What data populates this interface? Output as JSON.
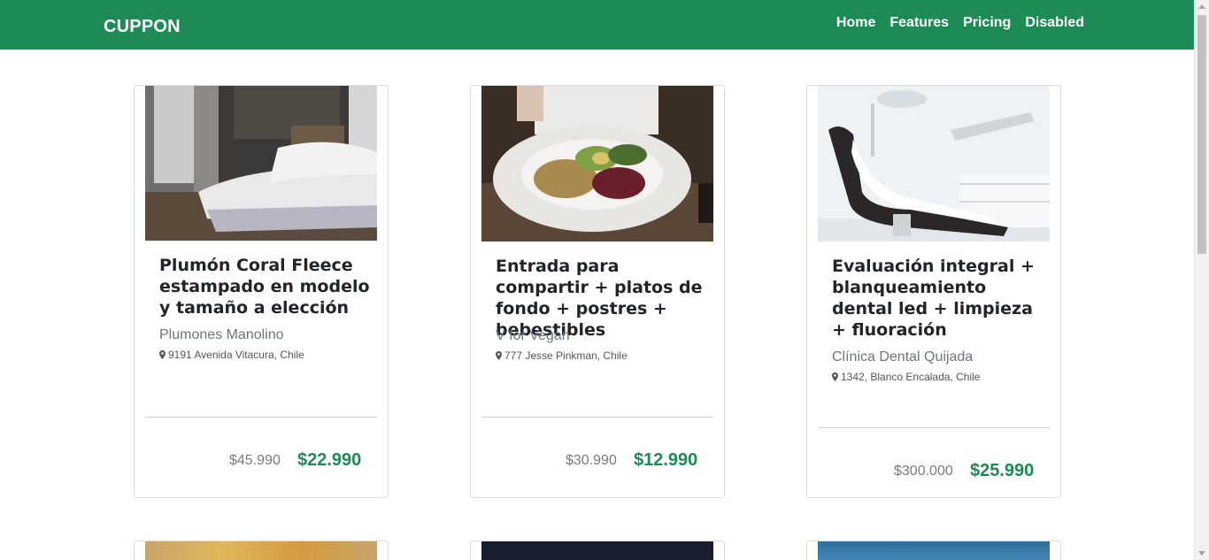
{
  "navbar": {
    "brand": "CUPPON",
    "links": [
      "Home",
      "Features",
      "Pricing",
      "Disabled"
    ]
  },
  "cards": [
    {
      "title": "Plumón Coral Fleece estampado en modelo y tamaño a elección",
      "vendor": "Plumones Manolino",
      "address": "9191 Avenida Vitacura, Chile",
      "old_price": "$45.990",
      "new_price": "$22.990",
      "image": "bedroom-bed-photo"
    },
    {
      "title": "Entrada para compartir + platos de fondo + postres + bebestibles",
      "vendor": "V for Vegan",
      "address": "777 Jesse Pinkman, Chile",
      "old_price": "$30.990",
      "new_price": "$12.990",
      "image": "vegan-salad-plate-photo"
    },
    {
      "title": "Evaluación integral + blanqueamiento dental led + limpieza + fluoración",
      "vendor": "Clínica Dental Quijada",
      "address": "1342, Blanco Encalada, Chile",
      "old_price": "$300.000",
      "new_price": "$25.990",
      "image": "dental-chair-photo"
    }
  ],
  "colors": {
    "brand_green": "#1e8a55",
    "muted_text": "#6c757d"
  }
}
